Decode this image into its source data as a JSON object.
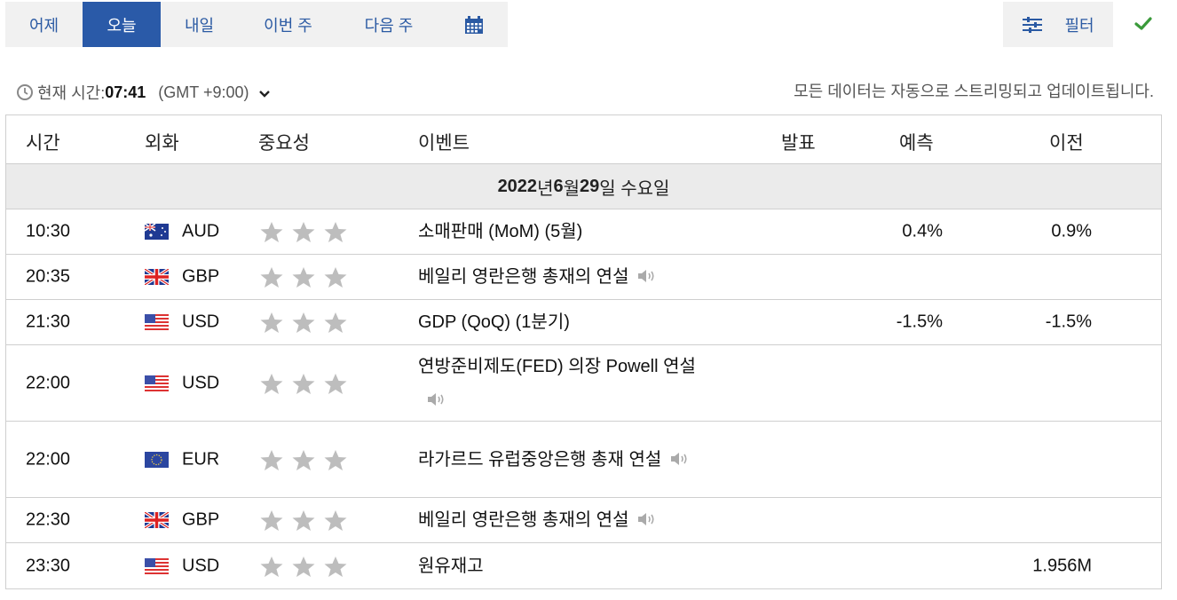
{
  "tabs": [
    {
      "label": "어제",
      "active": false
    },
    {
      "label": "오늘",
      "active": true
    },
    {
      "label": "내일",
      "active": false
    },
    {
      "label": "이번 주",
      "active": false
    },
    {
      "label": "다음 주",
      "active": false
    }
  ],
  "calendar_icon": "calendar-icon",
  "filter": {
    "label": "필터",
    "icon": "sliders-icon"
  },
  "status_icon": "check-icon",
  "info": {
    "time_label": "현재 시간:",
    "time_value": "07:41",
    "timezone": "(GMT +9:00)",
    "auto_update_text": "모든 데이터는 자동으로 스트리밍되고 업데이트됩니다."
  },
  "table": {
    "headers": {
      "time": "시간",
      "currency": "외화",
      "importance": "중요성",
      "event": "이벤트",
      "actual": "발표",
      "forecast": "예측",
      "previous": "이전"
    },
    "date": {
      "year": "2022",
      "year_suffix": "년 ",
      "month": "6",
      "month_suffix": "월 ",
      "day": "29",
      "day_suffix": "일 수요일"
    },
    "rows": [
      {
        "time": "10:30",
        "flag": "au-flag-icon",
        "currency": "AUD",
        "importance": 3,
        "event": "소매판매 (MoM) (5월)",
        "speech": false,
        "actual": "",
        "forecast": "0.4%",
        "previous": "0.9%"
      },
      {
        "time": "20:35",
        "flag": "gb-flag-icon",
        "currency": "GBP",
        "importance": 3,
        "event": "베일리 영란은행 총재의 연설",
        "speech": true,
        "actual": "",
        "forecast": "",
        "previous": ""
      },
      {
        "time": "21:30",
        "flag": "us-flag-icon",
        "currency": "USD",
        "importance": 3,
        "event": "GDP (QoQ) (1분기)",
        "speech": false,
        "actual": "",
        "forecast": "-1.5%",
        "previous": "-1.5%"
      },
      {
        "time": "22:00",
        "flag": "us-flag-icon",
        "currency": "USD",
        "importance": 3,
        "event": "연방준비제도(FED) 의장 Powell 연설",
        "speech": true,
        "actual": "",
        "forecast": "",
        "previous": ""
      },
      {
        "time": "22:00",
        "flag": "eu-flag-icon",
        "currency": "EUR",
        "importance": 3,
        "event": "라가르드 유럽중앙은행 총재 연설",
        "speech": true,
        "actual": "",
        "forecast": "",
        "previous": ""
      },
      {
        "time": "22:30",
        "flag": "gb-flag-icon",
        "currency": "GBP",
        "importance": 3,
        "event": "베일리 영란은행 총재의 연설",
        "speech": true,
        "actual": "",
        "forecast": "",
        "previous": ""
      },
      {
        "time": "23:30",
        "flag": "us-flag-icon",
        "currency": "USD",
        "importance": 3,
        "event": "원유재고",
        "speech": false,
        "actual": "",
        "forecast": "",
        "previous": "1.956M"
      }
    ]
  }
}
